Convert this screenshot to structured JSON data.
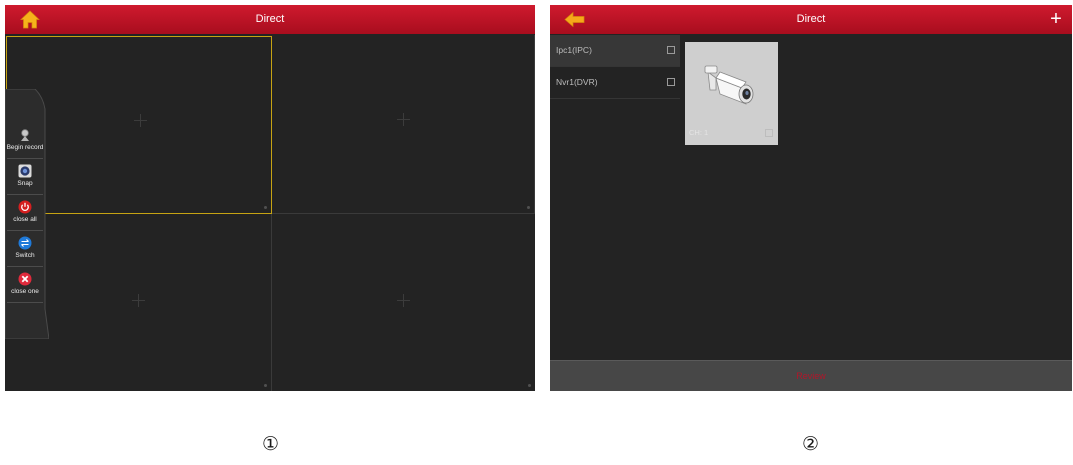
{
  "colors": {
    "header": "#c8172b",
    "panel_bg": "#232323",
    "selection": "#c6a313",
    "review_text": "#b1162a"
  },
  "screen1": {
    "header": {
      "title": "Direct",
      "home_icon": "home-icon"
    },
    "toolbar": [
      {
        "label": "Begin record",
        "icon": "camera-record-icon"
      },
      {
        "label": "Snap",
        "icon": "snap-icon"
      },
      {
        "label": "close all",
        "icon": "power-icon"
      },
      {
        "label": "Switch",
        "icon": "switch-icon"
      },
      {
        "label": "close one",
        "icon": "close-icon"
      }
    ]
  },
  "screen2": {
    "header": {
      "title": "Direct",
      "back_icon": "back-arrow-icon",
      "add_label": "+"
    },
    "devices": [
      {
        "name": "Ipc1(IPC)"
      },
      {
        "name": "Nvr1(DVR)"
      }
    ],
    "channel": {
      "label": "CH: 1"
    },
    "bottom": {
      "label": "Review"
    }
  },
  "captions": [
    "①",
    "②"
  ]
}
